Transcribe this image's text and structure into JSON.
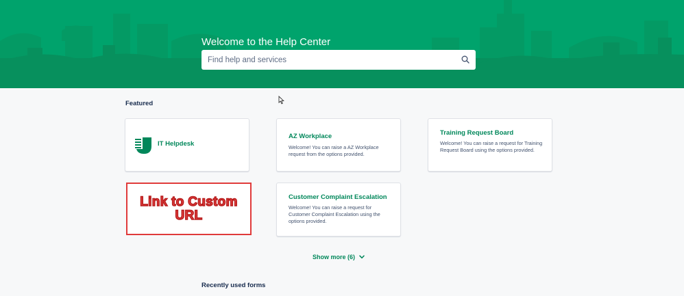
{
  "hero": {
    "title": "Welcome to the Help Center",
    "search_placeholder": "Find help and services",
    "bg_color": "#00a36c"
  },
  "featured": {
    "heading": "Featured",
    "cards": [
      {
        "title": "IT Helpdesk",
        "description": "",
        "icon": "helpdesk-logo-icon"
      },
      {
        "title": "AZ Workplace",
        "description": "Welcome! You can raise a AZ Workplace request from the options provided."
      },
      {
        "title": "Training Request Board",
        "description": "Welcome! You can raise a request for Training Request Board using the options provided."
      },
      {
        "title": "Customer Complaint Escalation",
        "description": "Welcome! You can raise a request for Customer Complaint Escalation using the options provided."
      }
    ],
    "custom_link": {
      "line1": "Link to Custom",
      "line2": "URL",
      "border_color": "#e03a3a"
    },
    "show_more": "Show more (6)"
  },
  "recent": {
    "heading": "Recently used forms"
  },
  "accent_color": "#00875a"
}
